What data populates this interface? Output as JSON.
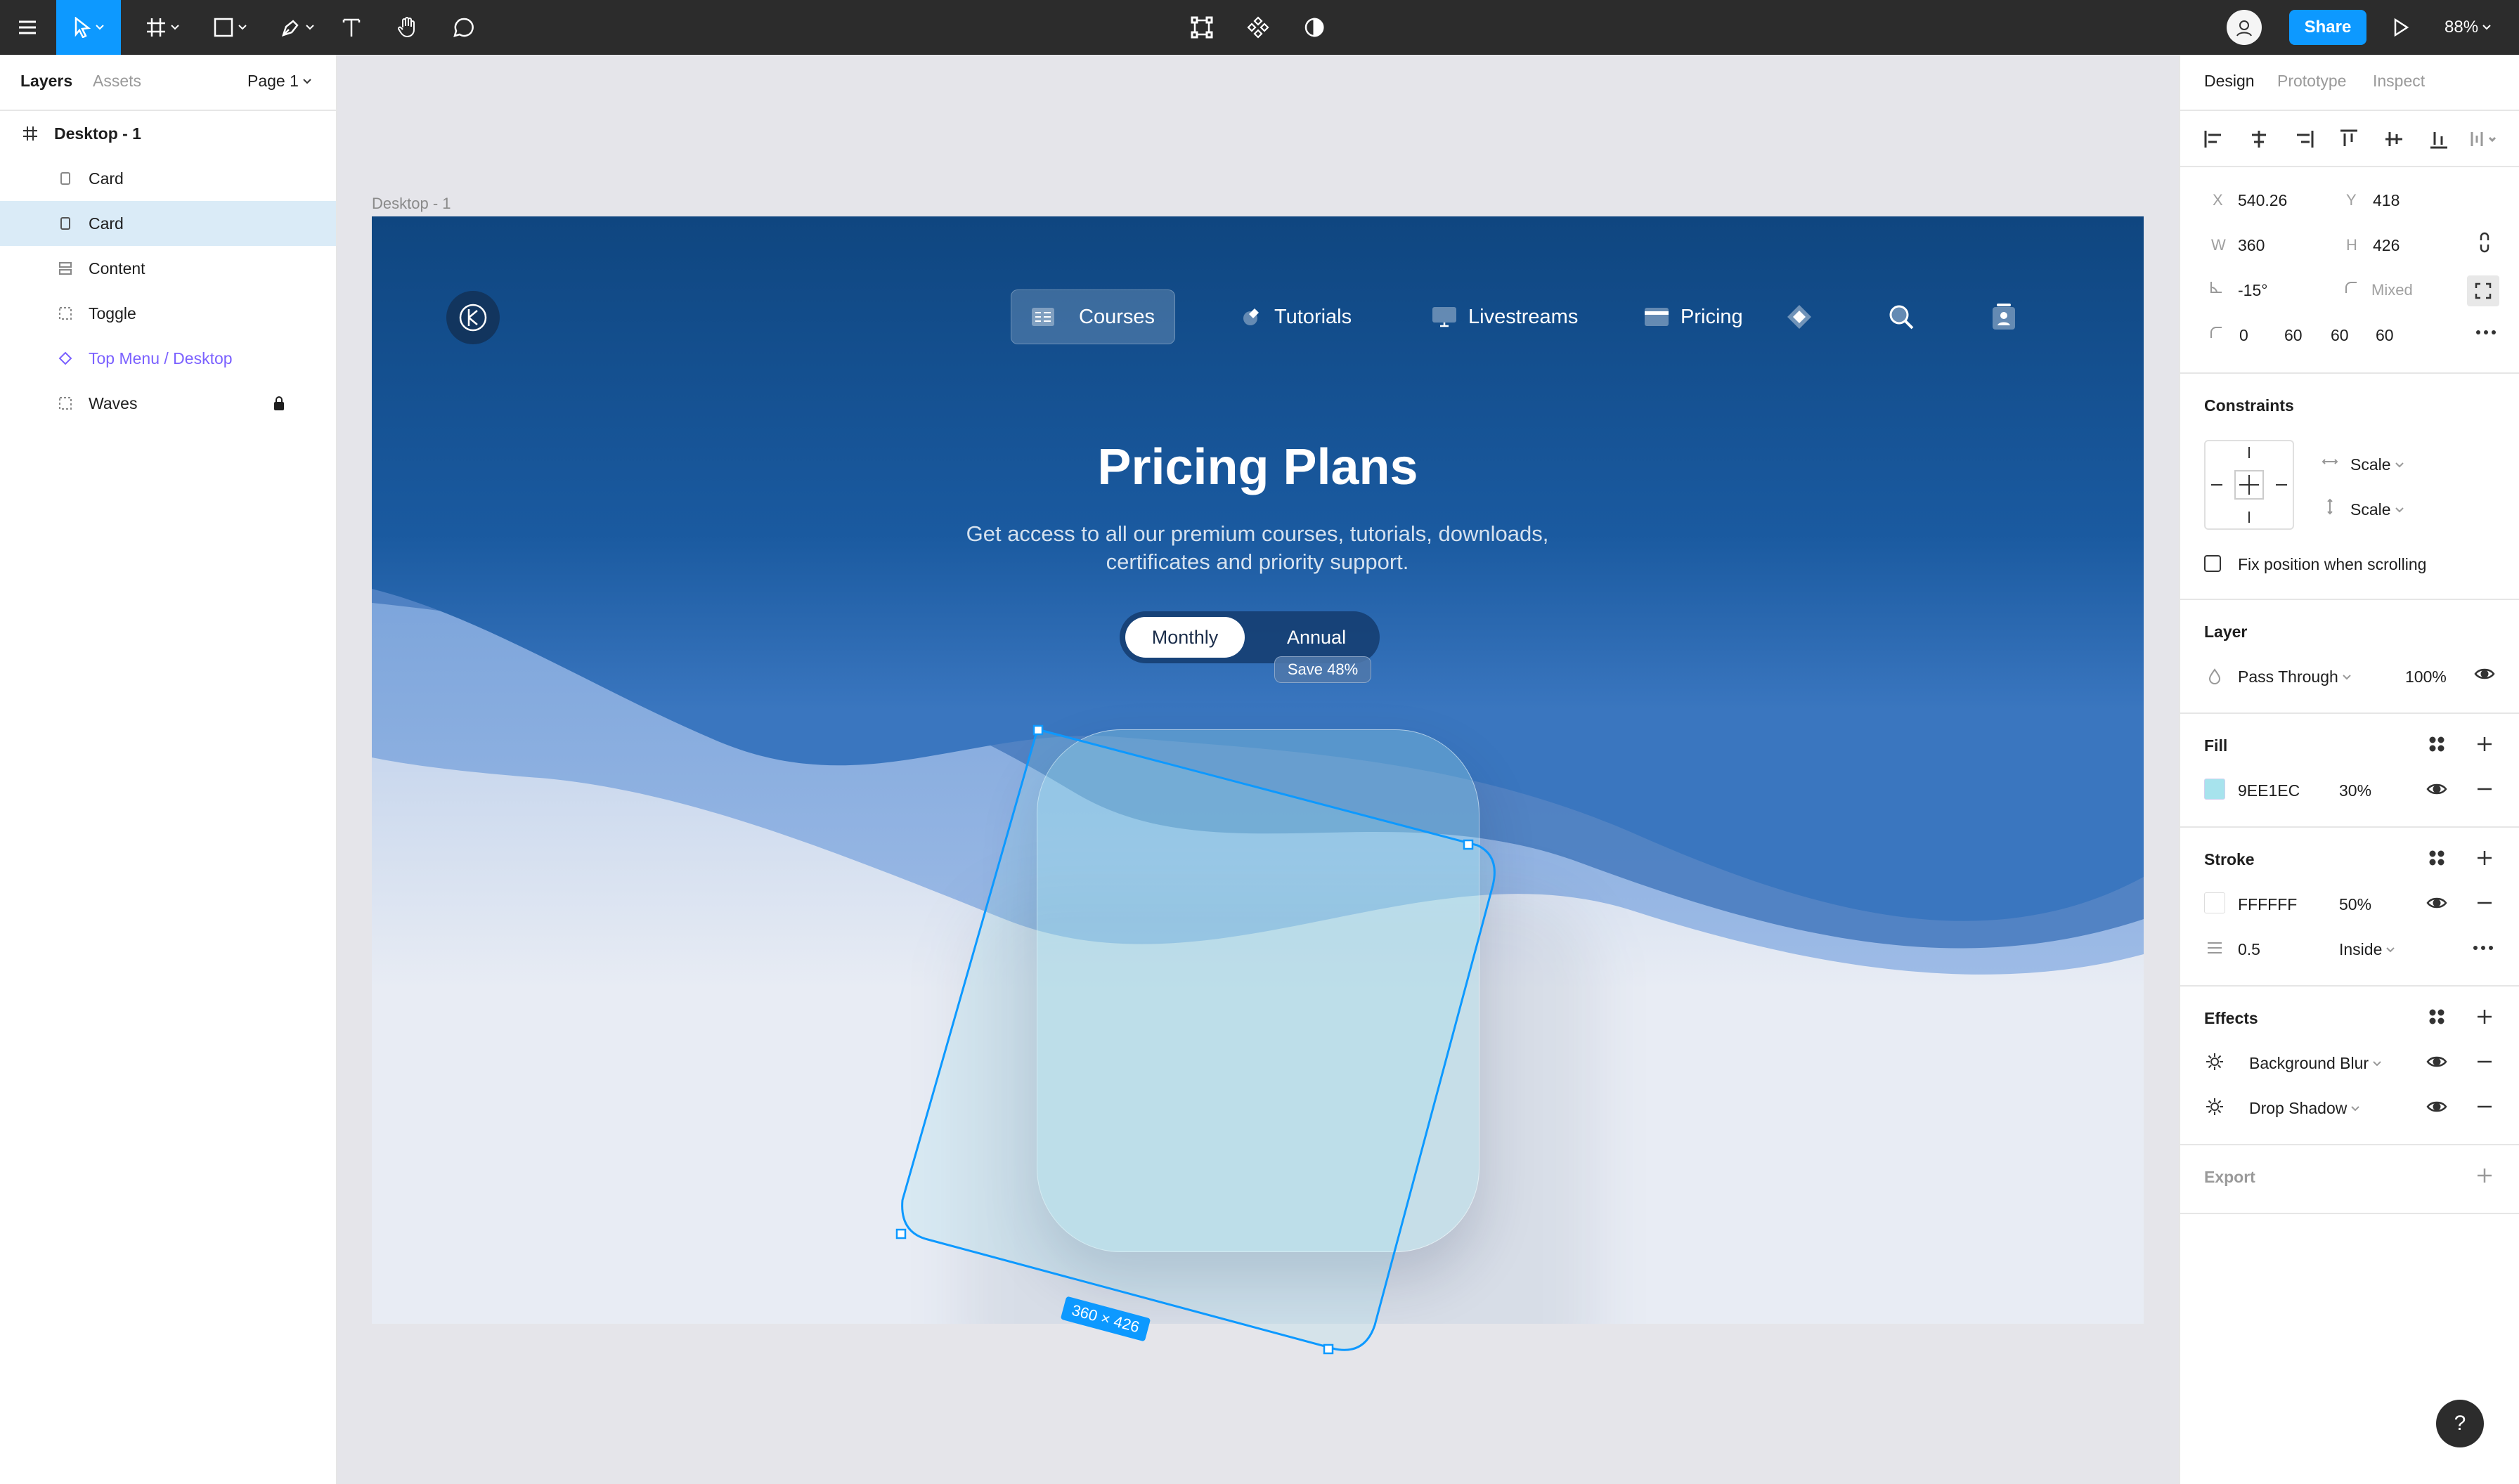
{
  "toolbar": {
    "share_label": "Share",
    "zoom": "88%",
    "icons": [
      "menu-icon",
      "move-icon",
      "frame-icon",
      "shape-icon",
      "pen-icon",
      "text-icon",
      "hand-icon",
      "comment-icon",
      "edit-object-icon",
      "component-icon",
      "mask-icon",
      "play-icon"
    ]
  },
  "left_panel": {
    "tabs": {
      "layers": "Layers",
      "assets": "Assets"
    },
    "page_selector": "Page 1",
    "frame_name": "Desktop - 1",
    "layers": [
      {
        "label": "Card",
        "icon": "rect"
      },
      {
        "label": "Card",
        "icon": "rect",
        "selected": true
      },
      {
        "label": "Content",
        "icon": "list"
      },
      {
        "label": "Toggle",
        "icon": "dashed"
      },
      {
        "label": "Top Menu / Desktop",
        "icon": "component",
        "color": "#7b61ff"
      },
      {
        "label": "Waves",
        "icon": "dashed",
        "locked": true
      }
    ]
  },
  "canvas": {
    "frame_label": "Desktop - 1",
    "nav": {
      "courses": "Courses",
      "tutorials": "Tutorials",
      "livestreams": "Livestreams",
      "pricing": "Pricing"
    },
    "hero": {
      "title": "Pricing Plans",
      "subtitle": "Get access to all our premium courses, tutorials, downloads, certificates and priority support."
    },
    "toggle": {
      "monthly": "Monthly",
      "annual": "Annual",
      "badge": "Save 48%"
    },
    "selection_size": "360 × 426",
    "colors": {
      "accent": "#0d99ff",
      "frame_top": "#13497f",
      "card_fill": "#9EE1EC"
    }
  },
  "right_panel": {
    "tabs": {
      "design": "Design",
      "prototype": "Prototype",
      "inspect": "Inspect"
    },
    "position": {
      "x_label": "X",
      "x": "540.26",
      "y_label": "Y",
      "y": "418"
    },
    "size": {
      "w_label": "W",
      "w": "360",
      "h_label": "H",
      "h": "426"
    },
    "rotation": "-15°",
    "corner_mode": "Mixed",
    "radii": [
      "0",
      "60",
      "60",
      "60"
    ],
    "constraints": {
      "title": "Constraints",
      "horizontal": "Scale",
      "vertical": "Scale",
      "fix_position": "Fix position when scrolling"
    },
    "layer": {
      "title": "Layer",
      "blend": "Pass Through",
      "opacity": "100%"
    },
    "fill": {
      "title": "Fill",
      "hex": "9EE1EC",
      "opacity": "30%"
    },
    "stroke": {
      "title": "Stroke",
      "hex": "FFFFFF",
      "opacity": "50%",
      "weight": "0.5",
      "position": "Inside"
    },
    "effects": {
      "title": "Effects",
      "items": [
        "Background Blur",
        "Drop Shadow"
      ]
    },
    "export": {
      "title": "Export"
    }
  },
  "help": "?"
}
